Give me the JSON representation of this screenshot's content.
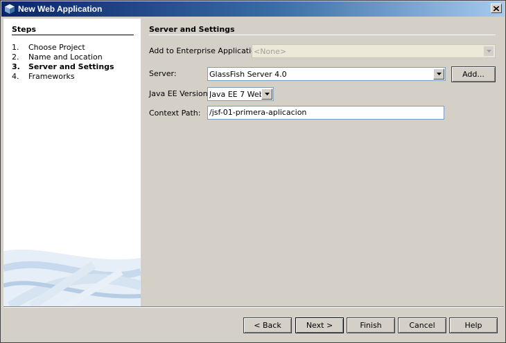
{
  "window": {
    "title": "New Web Application"
  },
  "steps": {
    "title": "Steps",
    "items": [
      {
        "num": "1.",
        "label": "Choose Project",
        "current": false
      },
      {
        "num": "2.",
        "label": "Name and Location",
        "current": false
      },
      {
        "num": "3.",
        "label": "Server and Settings",
        "current": true
      },
      {
        "num": "4.",
        "label": "Frameworks",
        "current": false
      }
    ]
  },
  "panel": {
    "title": "Server and Settings",
    "enterprise_label": "Add to Enterprise Application:",
    "enterprise_value": "<None>",
    "server_label": "Server:",
    "server_value": "GlassFish Server 4.0",
    "add_button": "Add...",
    "javaee_label": "Java EE Version:",
    "javaee_value": "Java EE 7 Web",
    "context_label": "Context Path:",
    "context_value": "/jsf-01-primera-aplicacion"
  },
  "buttons": {
    "back": "< Back",
    "next": "Next >",
    "finish": "Finish",
    "cancel": "Cancel",
    "help": "Help"
  },
  "colors": {
    "title_bar_start": "#0a246a",
    "title_bar_end": "#a6caf0",
    "dialog_bg": "#d4d0c8"
  }
}
